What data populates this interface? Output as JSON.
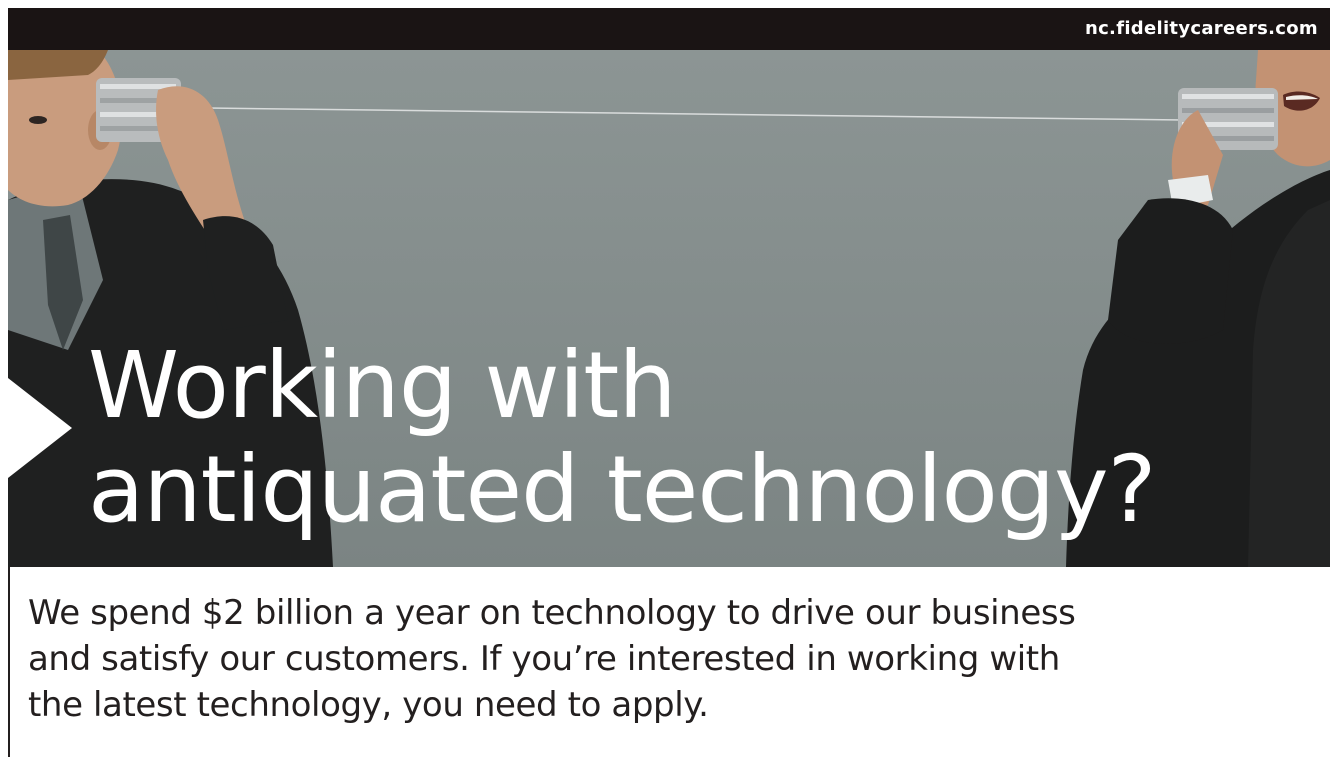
{
  "site_url": "nc.fidelitycareers.com",
  "headline": {
    "line1": "Working with",
    "line2": "antiquated technology?"
  },
  "body_copy": {
    "line1": "We spend $2 billion a year on technology to drive our business",
    "line2": "and satisfy our customers. If you’re interested in working with",
    "line3": "the latest technology, you need to apply."
  },
  "colors": {
    "top_bar": "#1a1414",
    "hero_background": "#838c8b",
    "headline_text": "#ffffff",
    "body_text": "#231f1f"
  }
}
